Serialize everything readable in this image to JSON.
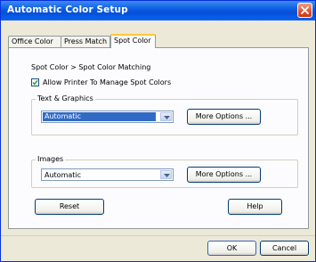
{
  "window": {
    "title": "Automatic Color Setup"
  },
  "tabs": [
    {
      "label": "Office Color"
    },
    {
      "label": "Press Match"
    },
    {
      "label": "Spot Color"
    }
  ],
  "panel": {
    "breadcrumb": "Spot Color > Spot Color Matching",
    "allow_spot": {
      "label": "Allow Printer To Manage Spot Colors",
      "checked": true
    },
    "text_graphics": {
      "label": "Text & Graphics",
      "value": "Automatic",
      "more_options": "More Options ..."
    },
    "images": {
      "label": "Images",
      "value": "Automatic",
      "more_options": "More Options ..."
    },
    "reset_label": "Reset",
    "help_label": "Help"
  },
  "footer": {
    "ok_label": "OK",
    "cancel_label": "Cancel"
  },
  "icons": {
    "close": "close-icon",
    "dropdown": "chevron-down-icon",
    "check": "checkmark-icon"
  },
  "colors": {
    "titlebar": "#0a5ae0",
    "selection": "#316ac5",
    "active_tab_accent": "#ffc83c"
  }
}
